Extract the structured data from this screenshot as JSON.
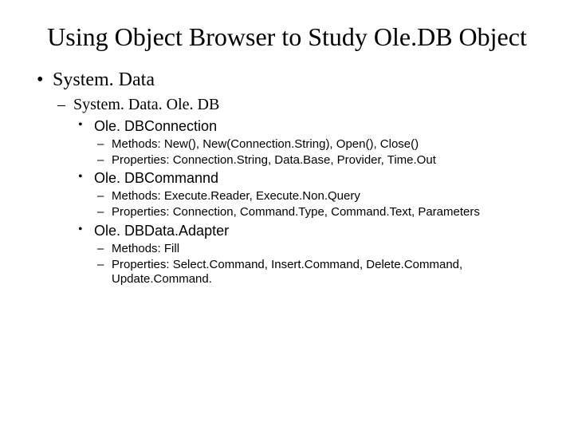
{
  "title": "Using Object Browser to Study Ole.DB Object",
  "l1": {
    "item": "System. Data",
    "l2": {
      "item": "System. Data. Ole. DB",
      "l3": [
        {
          "label": "Ole. DBConnection",
          "details": [
            "Methods: New(), New(Connection.String), Open(), Close()",
            "Properties: Connection.String, Data.Base, Provider, Time.Out"
          ]
        },
        {
          "label": "Ole. DBCommannd",
          "details": [
            "Methods: Execute.Reader, Execute.Non.Query",
            "Properties: Connection, Command.Type, Command.Text, Parameters"
          ]
        },
        {
          "label": "Ole. DBData.Adapter",
          "details": [
            "Methods: Fill",
            "Properties: Select.Command, Insert.Command, Delete.Command, Update.Command."
          ]
        }
      ]
    }
  }
}
